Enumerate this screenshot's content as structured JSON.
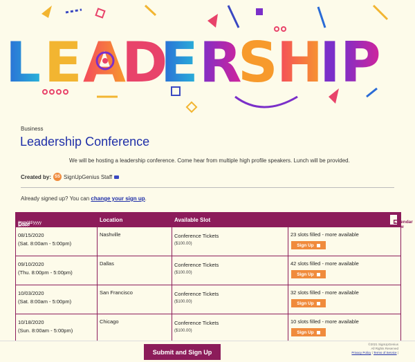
{
  "banner": {
    "text": "LEADERSHIP",
    "letters": [
      "L",
      "E",
      "A",
      "D",
      "E",
      "R",
      "S",
      "H",
      "I",
      "P"
    ]
  },
  "category": "Business",
  "title": "Leadership Conference",
  "description": "We will be hosting a leadership conference.  Come hear from multiple high profile speakers.  Lunch will be provided.",
  "creator": {
    "label": "Created by:",
    "initials": "SS",
    "name": "SignUpGenius Staff"
  },
  "already": {
    "text": "Already signed up? You can ",
    "link": "change your sign up",
    "suffix": "."
  },
  "table": {
    "headers": {
      "date": "Date",
      "date_format": "(mm/dd/yyyy EDT)",
      "location": "Location",
      "slot": "Available Slot",
      "calendar": "Calendar View"
    },
    "rows": [
      {
        "date": "08/15/2020",
        "time": "(Sat. 8:00am - 5:00pm)",
        "location": "Nashville",
        "slot": "Conference Tickets",
        "price": "($100.00)",
        "filled": "23 slots filled - more available",
        "button": "Sign Up"
      },
      {
        "date": "09/10/2020",
        "time": "(Thu. 8:00pm - 5:00pm)",
        "location": "Dallas",
        "slot": "Conference Tickets",
        "price": "($100.00)",
        "filled": "42 slots filled - more available",
        "button": "Sign Up"
      },
      {
        "date": "10/03/2020",
        "time": "(Sat. 8:00am - 5:00pm)",
        "location": "San Francisco",
        "slot": "Conference Tickets",
        "price": "($100.00)",
        "filled": "32 slots filled - more available",
        "button": "Sign Up"
      },
      {
        "date": "10/18/2020",
        "time": "(Sun. 8:00am - 5:00pm)",
        "location": "Chicago",
        "slot": "Conference Tickets",
        "price": "($100.00)",
        "filled": "10 slots filled - more available",
        "button": "Sign Up"
      }
    ]
  },
  "footer": {
    "submit": "Submit and Sign Up",
    "copyright": "©2021 SignUpGenius",
    "rights": "All Rights Reserved",
    "privacy": "Privacy Policy",
    "separator": "|",
    "terms": "Terms of Service",
    "trailing": "|"
  },
  "colors": {
    "accent": "#8c1c5a",
    "title": "#1f2fa8",
    "button": "#f08b3c",
    "background": "#fdfbea"
  }
}
